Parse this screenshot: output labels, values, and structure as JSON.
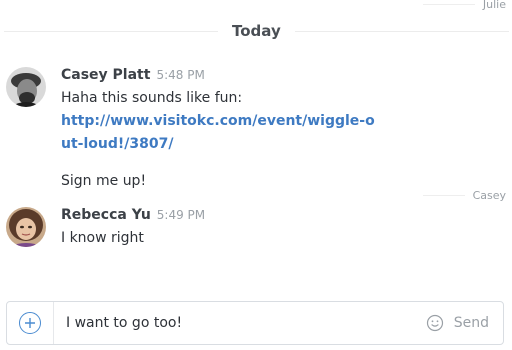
{
  "read_receipts": {
    "top": "Julie",
    "after_casey": "Casey"
  },
  "day_divider": {
    "label": "Today"
  },
  "messages": [
    {
      "author": "Casey Platt",
      "time": "5:48 PM",
      "text": "Haha this sounds like fun:",
      "link": "http://www.visitokc.com/event/wiggle-out-loud!/3807/",
      "text2": "Sign me up!"
    },
    {
      "author": "Rebecca Yu",
      "time": "5:49 PM",
      "text": "I know right"
    }
  ],
  "composer": {
    "value": "I want to go too!",
    "send_label": "Send",
    "add_icon": "plus-icon",
    "emoji_icon": "smiley-icon"
  },
  "colors": {
    "link": "#3e7ac2",
    "accent": "#4a8bd0"
  }
}
